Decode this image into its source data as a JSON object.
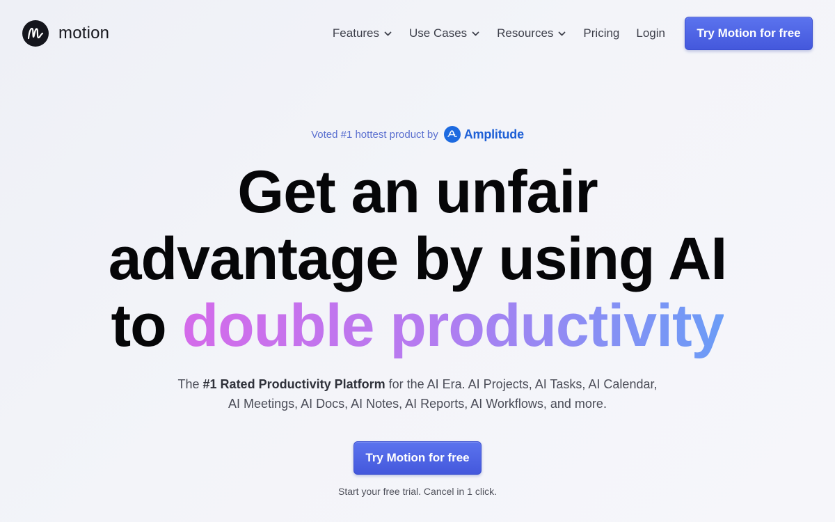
{
  "brand": {
    "name": "motion"
  },
  "nav": {
    "items": [
      {
        "label": "Features",
        "dropdown": true
      },
      {
        "label": "Use Cases",
        "dropdown": true
      },
      {
        "label": "Resources",
        "dropdown": true
      },
      {
        "label": "Pricing",
        "dropdown": false
      },
      {
        "label": "Login",
        "dropdown": false
      }
    ],
    "cta_label": "Try Motion for free"
  },
  "hero": {
    "voted_text": "Voted #1 hottest product by",
    "voted_brand": "Amplitude",
    "headline_line1": "Get an unfair",
    "headline_line2": "advantage by using AI",
    "headline_line3_prefix": "to ",
    "headline_line3_highlight": "double productivity",
    "subtitle_prefix": "The ",
    "subtitle_bold": "#1 Rated Productivity Platform",
    "subtitle_rest": " for the AI Era. AI Projects, AI Tasks, AI Calendar, AI Meetings, AI Docs, AI Notes, AI Reports, AI Workflows, and more.",
    "cta_label": "Try Motion for free",
    "trial_note": "Start your free trial. Cancel in 1 click."
  },
  "colors": {
    "primary_button": "#4a5fe2",
    "voted_text": "#5a6fcf",
    "amplitude_blue": "#1d6ae0",
    "gradient_start": "#d46bea",
    "gradient_end": "#6b9cf6"
  },
  "icons": {
    "logo": "motion-logo-icon",
    "dropdown": "chevron-down-icon",
    "amplitude": "amplitude-logo-icon"
  }
}
